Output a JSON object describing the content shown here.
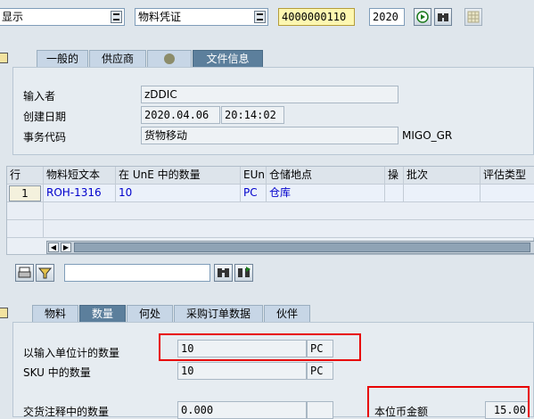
{
  "header": {
    "action_value": "显示",
    "doc_type_value": "物料凭证",
    "doc_number": "4000000110",
    "year": "2020"
  },
  "header_tabs": [
    {
      "label": "一般的"
    },
    {
      "label": "供应商"
    },
    {
      "label": "文件信息"
    }
  ],
  "doc_info": {
    "entered_by_label": "输入者",
    "entered_by_value": "zDDIC",
    "created_label": "创建日期",
    "created_date": "2020.04.06",
    "created_time": "20:14:02",
    "tcode_label": "事务代码",
    "tcode_desc": "货物移动",
    "tcode_value": "MIGO_GR"
  },
  "items_table": {
    "columns": [
      "行",
      "物料短文本",
      "在 UnE 中的数量",
      "EUn",
      "仓储地点",
      "操",
      "批次",
      "评估类型"
    ],
    "rows": [
      [
        "1",
        "ROH-1316",
        "10",
        "PC",
        "仓库",
        "",
        "",
        ""
      ]
    ]
  },
  "detail_tabs": [
    {
      "label": "物料"
    },
    {
      "label": "数量"
    },
    {
      "label": "何处"
    },
    {
      "label": "采购订单数据"
    },
    {
      "label": "伙伴"
    }
  ],
  "quantity": {
    "entry_qty_label": "以输入单位计的数量",
    "entry_qty_value": "10",
    "entry_unit": "PC",
    "sku_label": "SKU 中的数量",
    "sku_value": "10",
    "sku_unit": "PC",
    "delivery_label": "交货注释中的数量",
    "delivery_value": "0.000",
    "amount_label": "本位币金额",
    "amount_value": "15.00"
  },
  "colors": {
    "highlight_border": "#e80000",
    "active_tab": "#5c7f9c",
    "doc_number_bg": "#fdf7b0"
  }
}
